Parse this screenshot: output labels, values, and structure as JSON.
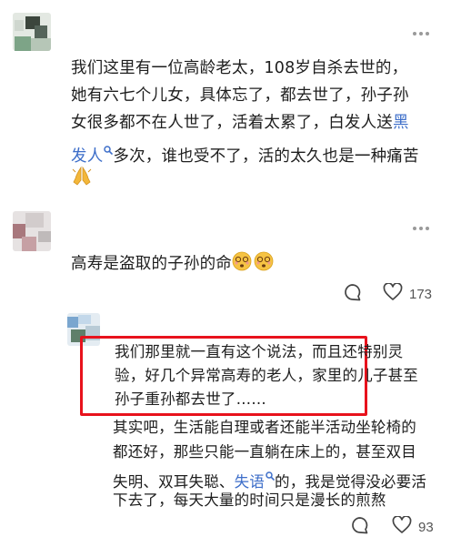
{
  "comments": [
    {
      "lines": [
        "我们这里有一位高龄老太，108岁自杀去世的，",
        "她有六七个儿女，具体忘了，都去世了，孙子孙",
        "女很多都不在人世了，活着太累了，白发人送"
      ],
      "line3_link_start": "黑",
      "line4_link_end": "发人",
      "line4_rest": "多次，谁也受不了，活的太久也是一种痛苦",
      "emoji": "pray-hands-emoji"
    },
    {
      "text": "高寿是盗取的子孙的命",
      "emoji": "dizzy-face-emoji",
      "comment_icon": "comment-icon",
      "like_icon": "heart-icon",
      "like_count": "173"
    }
  ],
  "reply": {
    "highlighted_lines": [
      "我们那里就一直有这个说法，而且还特别灵",
      "验，好几个异常高寿的老人，家里的儿子甚至",
      "孙子重孙都去世了……"
    ],
    "lines": [
      "其实吧，生活能自理或者还能半活动坐轮椅的",
      "都还好，那些只能一直躺在床上的，甚至双目"
    ],
    "line3_before": "失明、双耳失聪、",
    "line3_link": "失语",
    "line3_after": "的，我是觉得没必要活",
    "line4": "下去了，每天大量的时间只是漫长的煎熬",
    "comment_icon": "comment-icon",
    "like_icon": "heart-icon",
    "like_count": "93"
  },
  "colors": {
    "link": "#3d6ec9",
    "highlight_border": "#e8121c",
    "text": "#1e1e1e",
    "meta": "#555555"
  }
}
